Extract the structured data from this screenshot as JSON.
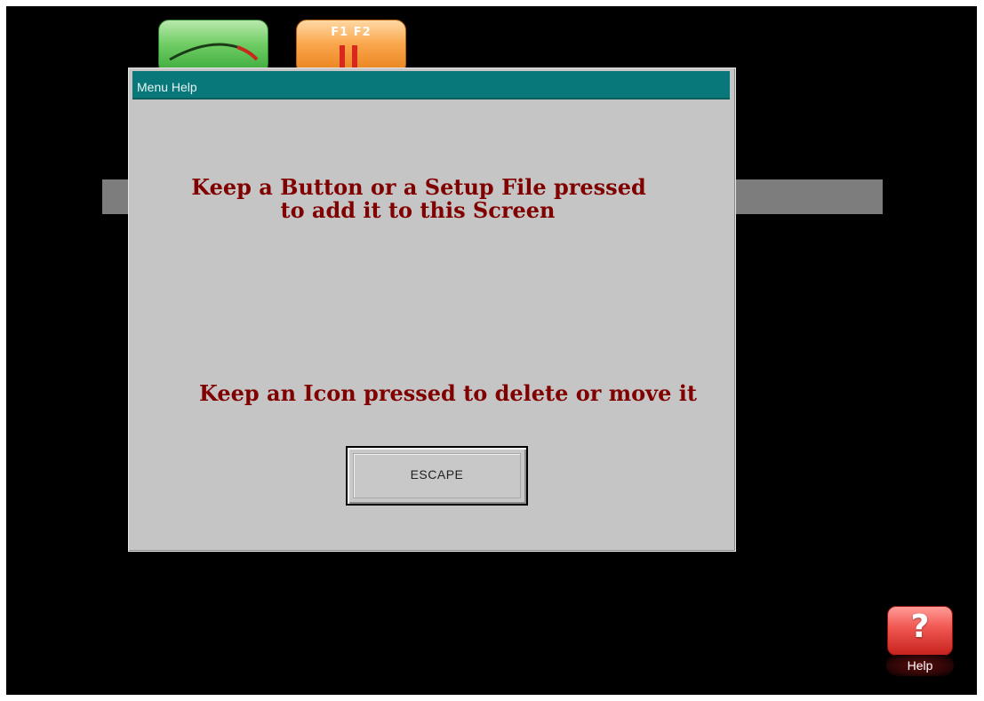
{
  "top_icons": {
    "fkey_label": "F1 F2"
  },
  "dialog": {
    "title": "Menu Help",
    "line1": "Keep a Button or a Setup File pressed",
    "line2": "to add it  to this Screen",
    "line3": "Keep an Icon pressed to delete or move it",
    "escape_label": "ESCAPE"
  },
  "help_button": {
    "symbol": "?",
    "label": "Help"
  },
  "colors": {
    "screen_background": "#000000",
    "dialog_background": "#c5c5c5",
    "title_bar": "#08787a",
    "help_text": "#800000",
    "help_icon": "#e8423d",
    "gauge_icon": "#6fcd64",
    "fkey_icon": "#f9a64b"
  },
  "icons": [
    "gauge-icon",
    "function-keys-icon",
    "question-mark-icon"
  ]
}
